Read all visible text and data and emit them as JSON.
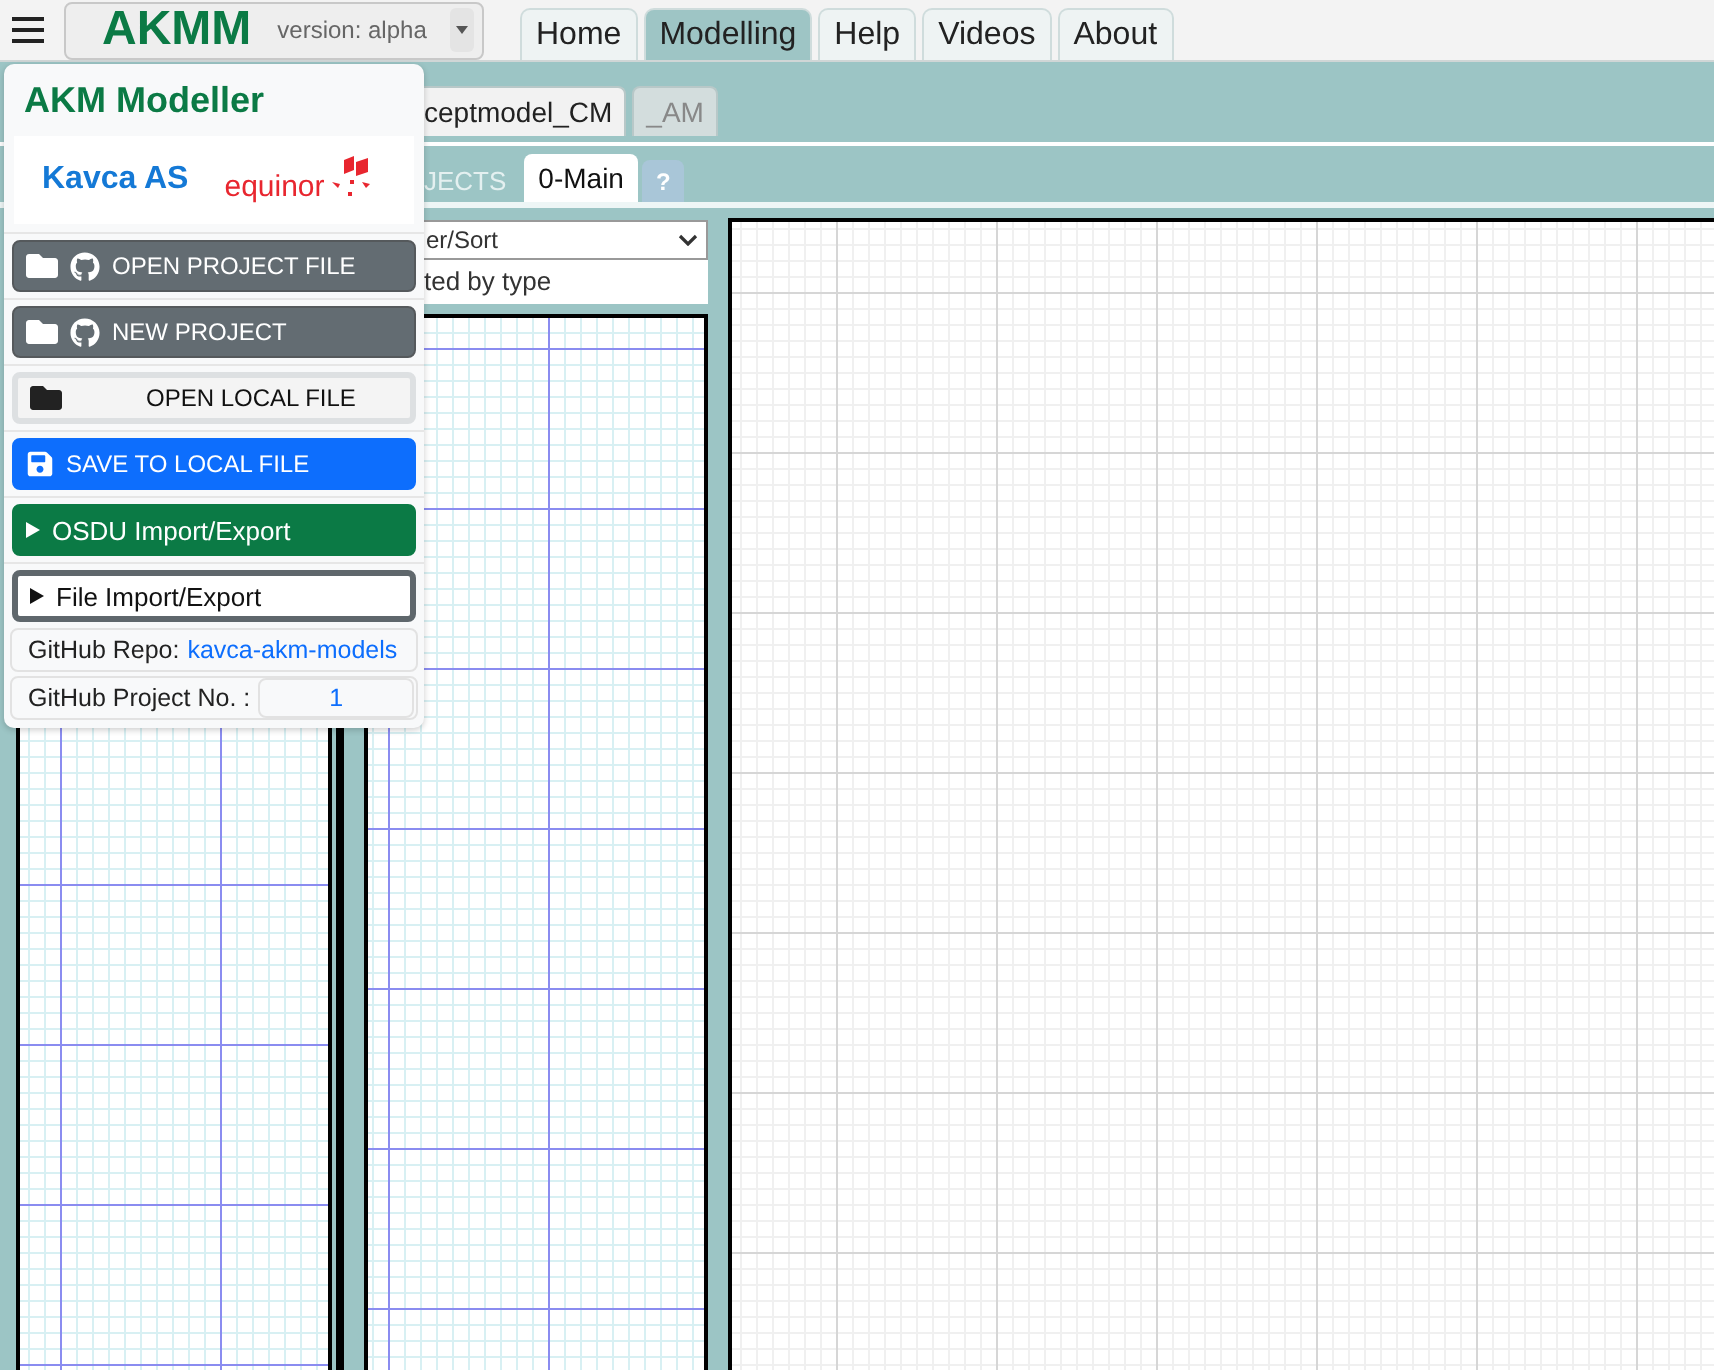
{
  "app": {
    "title": "AKMM",
    "version": "version: alpha"
  },
  "nav": [
    {
      "label": "Home",
      "selected": false
    },
    {
      "label": "Modelling",
      "selected": true
    },
    {
      "label": "Help",
      "selected": false
    },
    {
      "label": "Videos",
      "selected": false
    },
    {
      "label": "About",
      "selected": false
    }
  ],
  "model_tabs": [
    {
      "label": "ceptmodel_CM",
      "selected": true
    },
    {
      "label": "_AM",
      "selected": false
    }
  ],
  "view_tabs": [
    {
      "label": "JECTS",
      "selected": false
    },
    {
      "label": "0-Main",
      "selected": true
    },
    {
      "label": "?",
      "selected": false
    }
  ],
  "filter": {
    "value": "er/Sort",
    "caption": "ted by type"
  },
  "menu": {
    "title": "AKM Modeller",
    "logos": [
      "Kavca AS",
      "equinor"
    ],
    "buttons": [
      {
        "label": "OPEN PROJECT FILE",
        "kind": "github"
      },
      {
        "label": "NEW PROJECT",
        "kind": "github"
      },
      {
        "label": "OPEN LOCAL FILE",
        "kind": "local"
      },
      {
        "label": "SAVE TO LOCAL FILE",
        "kind": "save"
      },
      {
        "label": "OSDU Import/Export",
        "kind": "osdu"
      },
      {
        "label": "File Import/Export",
        "kind": "expander"
      }
    ],
    "repo_label": "GitHub Repo:",
    "repo": "kavca-akm-models",
    "project_label": "GitHub Project No. :",
    "project": "1"
  }
}
